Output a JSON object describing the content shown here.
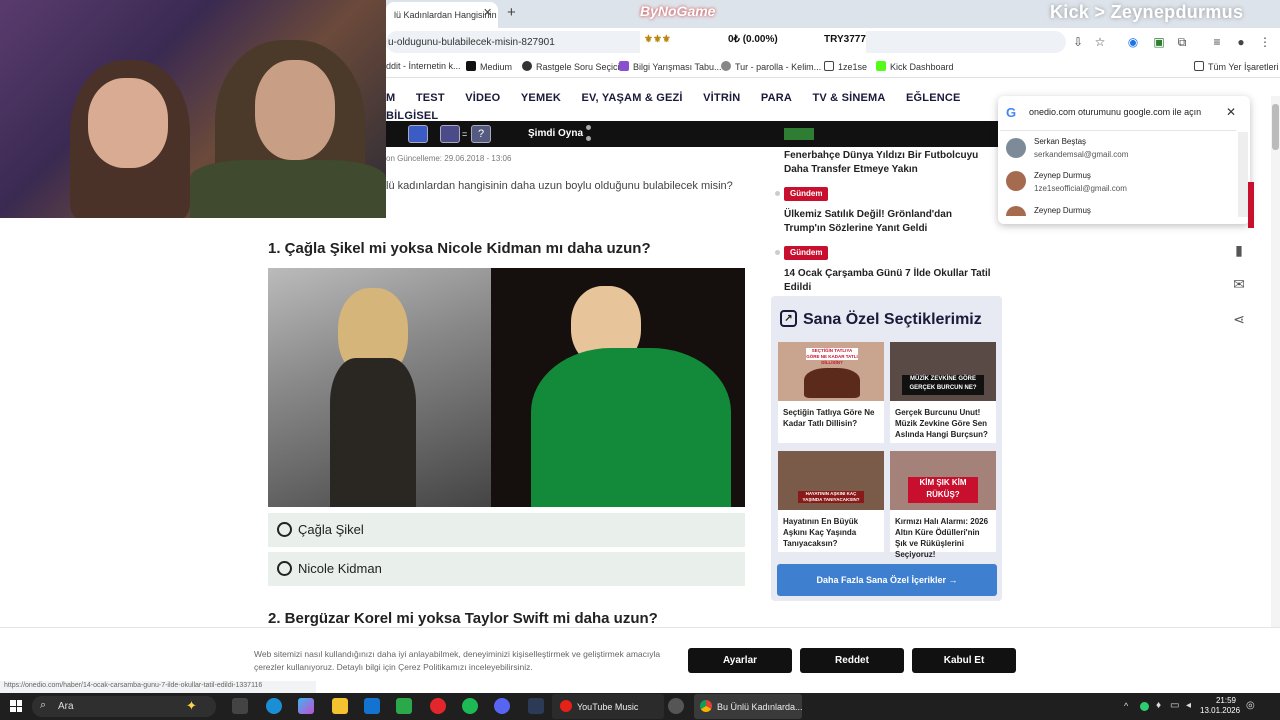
{
  "browser": {
    "active_tab_title": "lü Kadınlardan Hangisinin",
    "tab_close": "✕",
    "new_tab": "+",
    "url": "u-oldugunu-bulabilecek-misin-827901",
    "bookmarks": [
      {
        "label": "ddit - İnternetin k...",
        "icon_color": "#ff4500"
      },
      {
        "label": "Medium",
        "icon_color": "#111111"
      },
      {
        "label": "Rastgele Soru Seçici",
        "icon_color": "#333333"
      },
      {
        "label": "Bilgi Yarışması Tabu...",
        "icon_color": "#8a4fd1"
      },
      {
        "label": "Tur - parolla - Kelim...",
        "icon_color": "#888888"
      },
      {
        "label": "1ze1se",
        "icon_color": "#444444"
      },
      {
        "label": "Kick Dashboard",
        "icon_color": "#53fc18"
      },
      {
        "label": "Tüm Yer İşaretleri",
        "icon_color": "#444444"
      }
    ]
  },
  "overlay": {
    "sponsor": "ByNoGame",
    "channel": "Kick > Zeynepdurmus",
    "ticker_icons": "⚜⚜⚜",
    "ticker_value": "0₺ (0.00%)",
    "ticker_right": "TRY3777"
  },
  "site": {
    "nav": [
      "M",
      "TEST",
      "VİDEO",
      "YEMEK",
      "EV, YAŞAM & GEZİ",
      "VİTRİN",
      "PARA",
      "TV & SİNEMA",
      "EĞLENCE",
      "BİLGİSEL"
    ],
    "game_bar_button": "Şimdi Oyna",
    "game_bar_eq": "=",
    "game_bar_q": "?"
  },
  "article": {
    "updated": "on Güncelleme: 29.06.2018 - 13:06",
    "intro": "lü kadınlardan hangisinin daha uzun boylu olduğunu bulabilecek misin?",
    "questions": [
      {
        "title": "1. Çağla Şikel mi yoksa Nicole Kidman mı daha uzun?",
        "options": [
          "Çağla Şikel",
          "Nicole Kidman"
        ]
      },
      {
        "title": "2. Bergüzar Korel mi yoksa Taylor Swift mi daha uzun?"
      }
    ]
  },
  "sidebar": {
    "news": [
      {
        "title": "Fenerbahçe Dünya Yıldızı Bir Futbolcuyu Daha Transfer Etmeye Yakın"
      },
      {
        "badge": "Gündem",
        "title": "Ülkemiz Satılık Değil! Grönland'dan Trump'ın Sözlerine Yanıt Geldi"
      },
      {
        "badge": "Gündem",
        "title": "14 Ocak Çarşamba Günü 7 İlde Okullar Tatil Edildi"
      }
    ],
    "recs_title": "Sana Özel Seçtiklerimiz",
    "recs": [
      {
        "title": "Seçtiğin Tatlıya Göre Ne Kadar Tatlı Dillisin?",
        "img_caption": "SEÇTİĞİN TATLIYA GÖRE NE KADAR TATLI DİLLİSİN?",
        "img_color": "#c9a48f"
      },
      {
        "title": "Gerçek Burcunu Unut! Müzik Zevkine Göre Sen Aslında Hangi Burçsun?",
        "img_caption": "MÜZİK ZEVKİNE GÖRE GERÇEK BURCUN NE?",
        "img_color": "#5a4a45"
      },
      {
        "title": "Hayatının En Büyük Aşkını Kaç Yaşında Tanıyacaksın?",
        "img_caption": "HAYATININ AŞKINI KAÇ YAŞINDA TANIYACAKSIN?",
        "img_color": "#7a5a48"
      },
      {
        "title": "Kırmızı Halı Alarmı: 2026 Altın Küre Ödülleri'nin Şık ve Rüküşlerini Seçiyoruz!",
        "img_caption": "KİM ŞIK KİM RÜKÜŞ?",
        "img_color": "#a4827a"
      }
    ],
    "more_button": "Daha Fazla Sana Özel İçerikler →"
  },
  "google_popup": {
    "title": "onedio.com oturumunu google.com ile açın",
    "close": "✕",
    "accounts": [
      {
        "name": "Serkan Beştaş",
        "email": "serkandemsal@gmail.com"
      },
      {
        "name": "Zeynep Durmuş",
        "email": "1ze1seofficial@gmail.com"
      },
      {
        "name": "Zeynep Durmuş",
        "email": ""
      }
    ]
  },
  "cookie": {
    "text": "Web sitemizi nasıl kullandığınızı daha iyi anlayabilmek, deneyiminizi kişiselleştirmek ve geliştirmek amacıyla çerezler kullanıyoruz. Detaylı bilgi için Çerez Politikamızı inceleyebilirsiniz.",
    "buttons": [
      "Ayarlar",
      "Reddet",
      "Kabul Et"
    ]
  },
  "status_url": "https://onedio.com/haber/14-ocak-carsamba-gunu-7-ilde-okullar-tatil-edildi-1337116",
  "taskbar": {
    "search_placeholder": "Ara",
    "apps": [
      {
        "label": "YouTube Music"
      },
      {
        "label": "Bu Ünlü Kadınlarda..."
      }
    ],
    "time": "21:59",
    "date": "13.01.2026"
  }
}
